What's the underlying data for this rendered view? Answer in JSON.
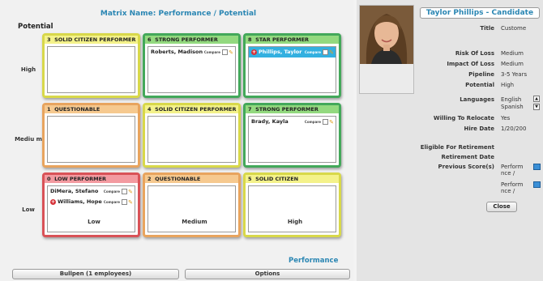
{
  "matrix": {
    "title": "Matrix Name: Performance / Potential",
    "y_axis_label": "Potential",
    "x_axis_label": "Performance",
    "rows": [
      "High",
      "Mediu m",
      "Low"
    ],
    "columns": [
      "Low",
      "Medium",
      "High"
    ]
  },
  "boxes": [
    {
      "num": "3",
      "title": "SOLID CITIZEN PERFORMER",
      "color": "#f4f28a",
      "employees": []
    },
    {
      "num": "6",
      "title": "STRONG PERFORMER",
      "color": "#93d97f",
      "employees": [
        {
          "name": "Roberts, Madison",
          "compare": "Compare"
        }
      ]
    },
    {
      "num": "8",
      "title": "STAR PERFORMER",
      "color": "#93d97f",
      "employees": [
        {
          "name": "Phillips, Taylor",
          "compare": "Compare"
        }
      ]
    },
    {
      "num": "1",
      "title": "QUESTIONABLE",
      "color": "#f6c98f",
      "employees": []
    },
    {
      "num": "4",
      "title": "SOLID CITIZEN PERFORMER",
      "color": "#f4f28a",
      "employees": []
    },
    {
      "num": "7",
      "title": "STRONG PERFORMER",
      "color": "#93d97f",
      "employees": [
        {
          "name": "Brady, Kayla",
          "compare": "Compare"
        }
      ]
    },
    {
      "num": "0",
      "title": "LOW PERFORMER",
      "color": "#f39aa0",
      "employees": [
        {
          "name": "DiMera, Stefano",
          "compare": "Compare"
        },
        {
          "name": "Williams, Hope",
          "compare": "Compare"
        }
      ]
    },
    {
      "num": "2",
      "title": "QUESTIONABLE",
      "color": "#f6c98f",
      "employees": []
    },
    {
      "num": "5",
      "title": "SOLID CITIZEN",
      "color": "#f4f28a",
      "employees": []
    }
  ],
  "footer": {
    "bullpen_label": "Bullpen (1 employees)",
    "options_label": "Options"
  },
  "profile": {
    "name": "Taylor Phillips - Candidate",
    "fields": [
      {
        "label": "Title",
        "value": "Custome"
      },
      {
        "label": "Risk Of Loss",
        "value": "Medium"
      },
      {
        "label": "Impact Of Loss",
        "value": "Medium"
      },
      {
        "label": "Pipeline",
        "value": "3-5 Years"
      },
      {
        "label": "Potential",
        "value": "High"
      },
      {
        "label": "Languages",
        "value": "English",
        "value2": "Spanish"
      },
      {
        "label": "Willing To Relocate",
        "value": "Yes"
      },
      {
        "label": "Hire Date",
        "value": "1/20/200"
      },
      {
        "label": "Eligible For Retirement",
        "value": ""
      },
      {
        "label": "Retirement Date",
        "value": ""
      },
      {
        "label": "Previous Score(s)",
        "value": "Perform nce /",
        "value2": "Perform nce /"
      }
    ],
    "close_label": "Close"
  },
  "icons": {
    "add": "plus-circle-icon",
    "edit": "pencil-icon",
    "calendar": "grid-calendar-icon"
  }
}
